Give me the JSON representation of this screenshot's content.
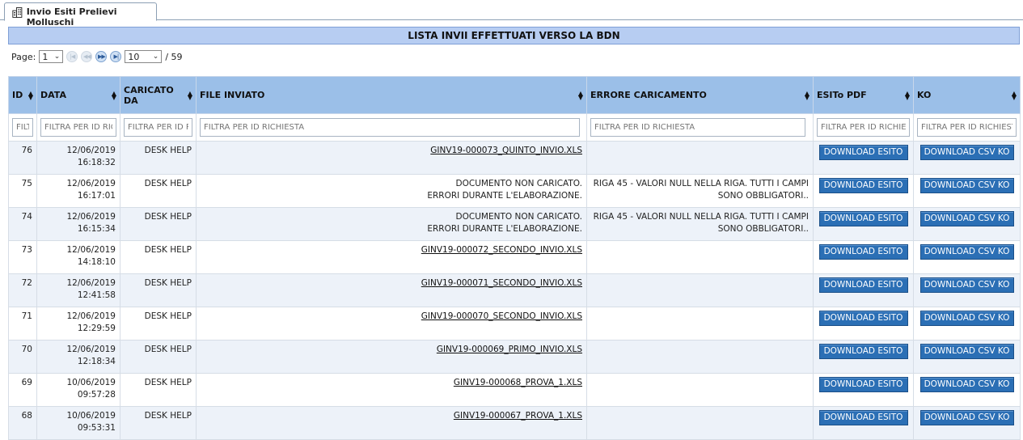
{
  "tab": {
    "label": "Invio Esiti Prelievi Molluschi",
    "icon": "building-icon"
  },
  "title": "LISTA INVII EFFETTUATI VERSO LA BDN",
  "pager": {
    "page_label": "Page:",
    "page_value": "1",
    "rows_value": "10",
    "total": "/ 59"
  },
  "columns": [
    "ID",
    "DATA",
    "CARICATO DA",
    "FILE INVIATO",
    "ERRORE CARICAMENTO",
    "ESITo PDF",
    "KO"
  ],
  "filters": {
    "id": "FILTRA PER ID RICHIESTA",
    "data": "FILTRA PER ID RICHIESTA",
    "caricato": "FILTRA PER ID RICHIESTA",
    "file": "FILTRA PER ID RICHIESTA",
    "errore": "FILTRA PER ID RICHIESTA",
    "esito": "FILTRA PER ID RICHIESTA",
    "ko": "FILTRA PER ID RICHIESTA"
  },
  "buttons": {
    "esito": "DOWNLOAD ESITO",
    "ko": "DOWNLOAD CSV KO"
  },
  "rows": [
    {
      "id": "76",
      "date": "12/06/2019",
      "time": "16:18:32",
      "user": "DESK HELP",
      "file": "GINV19-000073_QUINTO_INVIO.XLS",
      "file_line2": "",
      "is_link": true,
      "error": "",
      "error_line2": ""
    },
    {
      "id": "75",
      "date": "12/06/2019",
      "time": "16:17:01",
      "user": "DESK HELP",
      "file": "DOCUMENTO NON CARICATO.",
      "file_line2": "ERRORI DURANTE L'ELABORAZIONE.",
      "is_link": false,
      "error": "RIGA 45 - VALORI NULL NELLA RIGA. TUTTI I CAMPI",
      "error_line2": "SONO OBBLIGATORI.."
    },
    {
      "id": "74",
      "date": "12/06/2019",
      "time": "16:15:34",
      "user": "DESK HELP",
      "file": "DOCUMENTO NON CARICATO.",
      "file_line2": "ERRORI DURANTE L'ELABORAZIONE.",
      "is_link": false,
      "error": "RIGA 45 - VALORI NULL NELLA RIGA. TUTTI I CAMPI",
      "error_line2": "SONO OBBLIGATORI.."
    },
    {
      "id": "73",
      "date": "12/06/2019",
      "time": "14:18:10",
      "user": "DESK HELP",
      "file": "GINV19-000072_SECONDO_INVIO.XLS",
      "file_line2": "",
      "is_link": true,
      "error": "",
      "error_line2": ""
    },
    {
      "id": "72",
      "date": "12/06/2019",
      "time": "12:41:58",
      "user": "DESK HELP",
      "file": "GINV19-000071_SECONDO_INVIO.XLS",
      "file_line2": "",
      "is_link": true,
      "error": "",
      "error_line2": ""
    },
    {
      "id": "71",
      "date": "12/06/2019",
      "time": "12:29:59",
      "user": "DESK HELP",
      "file": "GINV19-000070_SECONDO_INVIO.XLS",
      "file_line2": "",
      "is_link": true,
      "error": "",
      "error_line2": ""
    },
    {
      "id": "70",
      "date": "12/06/2019",
      "time": "12:18:34",
      "user": "DESK HELP",
      "file": "GINV19-000069_PRIMO_INVIO.XLS",
      "file_line2": "",
      "is_link": true,
      "error": "",
      "error_line2": ""
    },
    {
      "id": "69",
      "date": "10/06/2019",
      "time": "09:57:28",
      "user": "DESK HELP",
      "file": "GINV19-000068_PROVA_1.XLS",
      "file_line2": "",
      "is_link": true,
      "error": "",
      "error_line2": ""
    },
    {
      "id": "68",
      "date": "10/06/2019",
      "time": "09:53:31",
      "user": "DESK HELP",
      "file": "GINV19-000067_PROVA_1.XLS",
      "file_line2": "",
      "is_link": true,
      "error": "",
      "error_line2": ""
    }
  ],
  "colors": {
    "header": "#9bbfe8",
    "title": "#b7cdf2",
    "button": "#2b6fb5",
    "alt_row": "#edf2f9"
  }
}
